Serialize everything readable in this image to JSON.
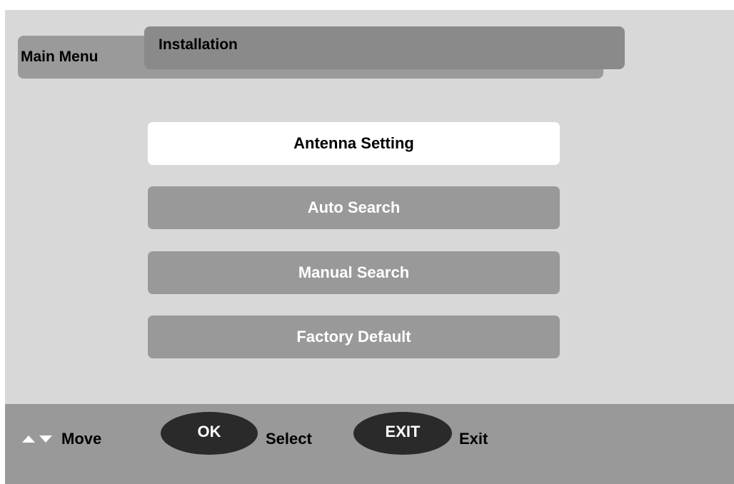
{
  "header": {
    "main_menu_label": "Main Menu",
    "section_title": "Installation"
  },
  "menu": {
    "items": [
      {
        "label": "Antenna Setting",
        "selected": true
      },
      {
        "label": "Auto Search",
        "selected": false
      },
      {
        "label": "Manual Search",
        "selected": false
      },
      {
        "label": "Factory Default",
        "selected": false
      }
    ]
  },
  "footer": {
    "move_label": "Move",
    "ok_button": "OK",
    "select_label": "Select",
    "exit_button": "EXIT",
    "exit_label": "Exit"
  },
  "icons": {
    "up": "arrow-up-icon",
    "down": "arrow-down-icon"
  },
  "colors": {
    "background": "#d8d8d8",
    "selected_item": "#ffffff",
    "unselected_item": "#999999",
    "footer": "#999999",
    "pill": "#2a2a2a"
  }
}
